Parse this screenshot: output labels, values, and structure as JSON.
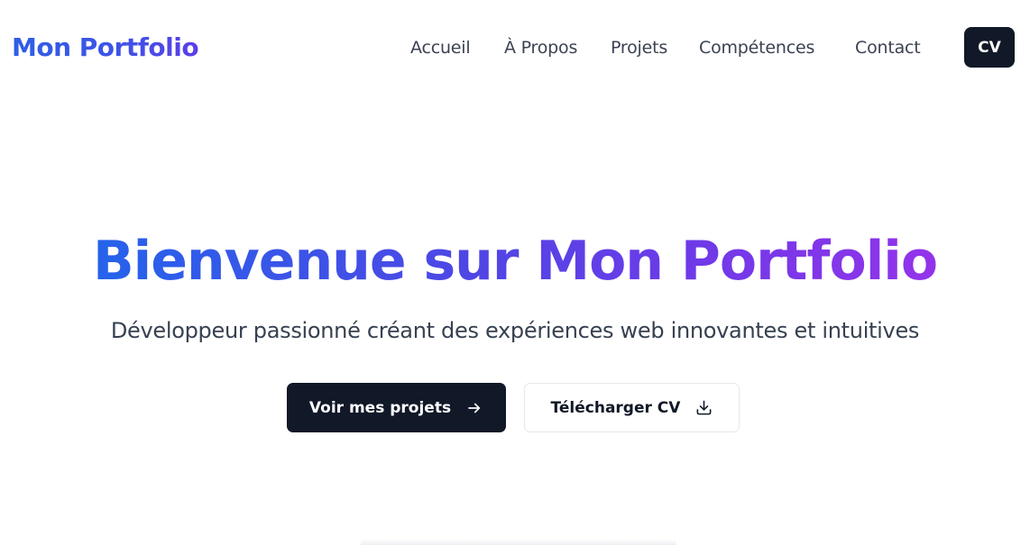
{
  "header": {
    "logo": "Mon Portfolio",
    "nav": [
      {
        "label": "Accueil"
      },
      {
        "label": "À Propos"
      },
      {
        "label": "Projets"
      },
      {
        "label": "Compétences"
      },
      {
        "label": "Contact"
      }
    ],
    "cv_button": "CV"
  },
  "hero": {
    "title": "Bienvenue sur Mon Portfolio",
    "subtitle": "Développeur passionné créant des expériences web innovantes et intuitives",
    "primary_button": {
      "label": "Voir mes projets",
      "icon": "arrow-right-icon"
    },
    "secondary_button": {
      "label": "Télécharger CV",
      "icon": "download-icon"
    }
  },
  "colors": {
    "gradient_start": "#2563eb",
    "gradient_end": "#9333ea",
    "dark": "#111827",
    "text_muted": "#374151"
  }
}
